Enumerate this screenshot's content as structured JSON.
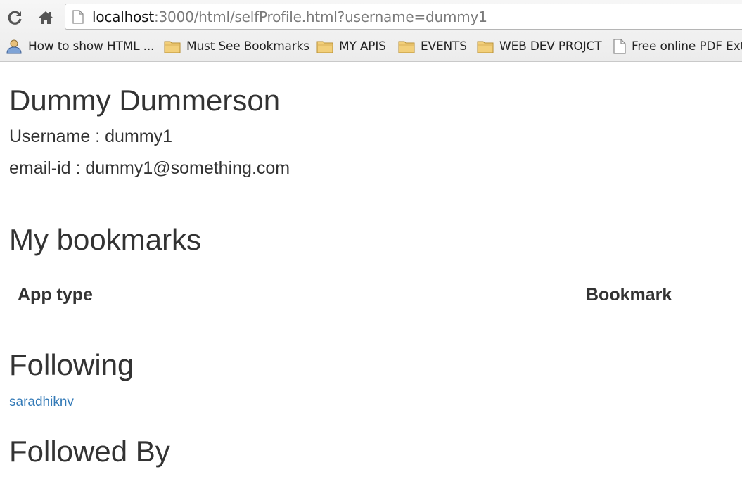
{
  "browser": {
    "url_host": "localhost",
    "url_rest": ":3000/html/selfProfile.html?username=dummy1",
    "bookmarks": [
      {
        "label": "How to show HTML ...",
        "icon": "user-icon"
      },
      {
        "label": "Must See Bookmarks",
        "icon": "folder-icon"
      },
      {
        "label": "MY APIS",
        "icon": "folder-icon"
      },
      {
        "label": "EVENTS",
        "icon": "folder-icon"
      },
      {
        "label": "WEB DEV PROJCT",
        "icon": "folder-icon"
      },
      {
        "label": "Free online PDF Ext",
        "icon": "page-icon"
      }
    ]
  },
  "profile": {
    "full_name": "Dummy Dummerson",
    "username_line": "Username : dummy1",
    "email_line": "email-id : dummy1@something.com"
  },
  "bookmarks_section": {
    "title": "My bookmarks",
    "columns": [
      "App type",
      "Bookmark"
    ]
  },
  "following": {
    "title": "Following",
    "users": [
      "saradhiknv"
    ]
  },
  "followed_by": {
    "title": "Followed By"
  },
  "colors": {
    "text": "#333333",
    "link": "#337ab7"
  }
}
